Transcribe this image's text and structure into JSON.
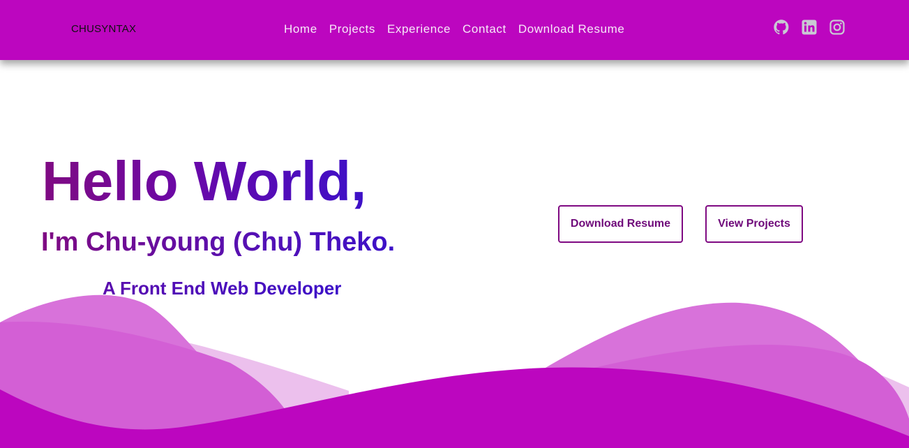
{
  "navbar": {
    "brand": "CHUSYNTAX",
    "links": [
      "Home",
      "Projects",
      "Experience",
      "Contact",
      "Download Resume"
    ],
    "social_icons": [
      "github-icon",
      "linkedin-icon",
      "instagram-icon"
    ]
  },
  "hero": {
    "title": "Hello World,",
    "subtitle": "I'm Chu-young (Chu) Theko.",
    "role": "A Front End Web Developer"
  },
  "buttons": {
    "download_resume": "Download Resume",
    "view_projects": "View Projects"
  },
  "colors": {
    "brand_purple": "#bc06bf",
    "nav_text": "#f7e9f8",
    "button_border": "#7f0a82",
    "wave_light": "#ecc0ed",
    "wave_mid": "#d872da",
    "wave_deep": "#d35fd5"
  }
}
